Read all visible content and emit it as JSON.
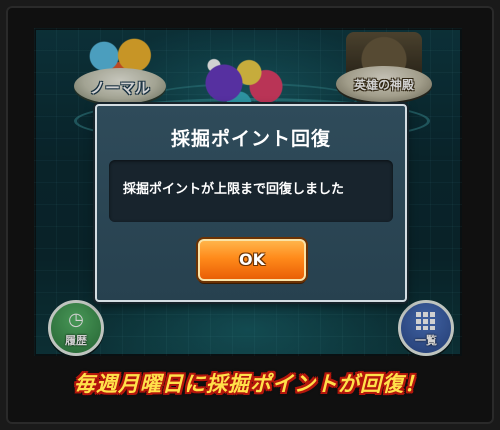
{
  "background": {
    "stage_normal_label": "ノーマル",
    "stage_hero_label": "英雄の神殿",
    "history_button_label": "履歴",
    "list_button_label": "一覧"
  },
  "dialog": {
    "title": "採掘ポイント回復",
    "message": "採掘ポイントが上限まで回復しました",
    "ok_label": "OK"
  },
  "caption": "毎週月曜日に採掘ポイントが回復！",
  "colors": {
    "dialog_bg": "#2f4b5a",
    "ok_button": "#ff8a1a",
    "caption_text": "#ffe14a",
    "caption_outline": "#b4160c"
  }
}
